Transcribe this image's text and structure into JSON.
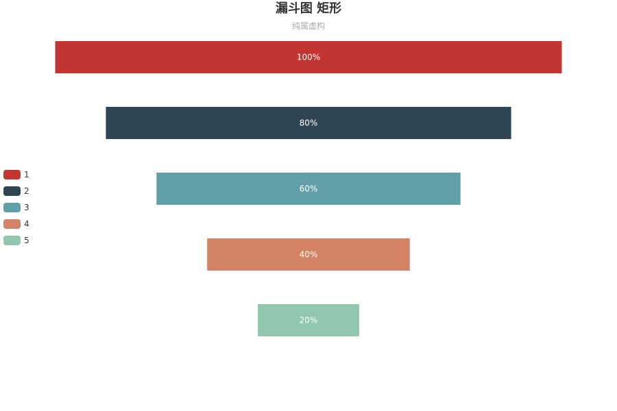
{
  "chart_data": {
    "type": "funnel",
    "title": "漏斗图 矩形",
    "subtitle": "纯属虚构",
    "sort": "descending",
    "legend_position": "left",
    "series": [
      {
        "data": [
          {
            "name": "1",
            "value": 100,
            "label": "100%",
            "color": "#c23531"
          },
          {
            "name": "2",
            "value": 80,
            "label": "80%",
            "color": "#2f4554"
          },
          {
            "name": "3",
            "value": 60,
            "label": "60%",
            "color": "#61a0a8"
          },
          {
            "name": "4",
            "value": 40,
            "label": "40%",
            "color": "#d48265"
          },
          {
            "name": "5",
            "value": 20,
            "label": "20%",
            "color": "#91c7ae"
          }
        ]
      }
    ]
  }
}
